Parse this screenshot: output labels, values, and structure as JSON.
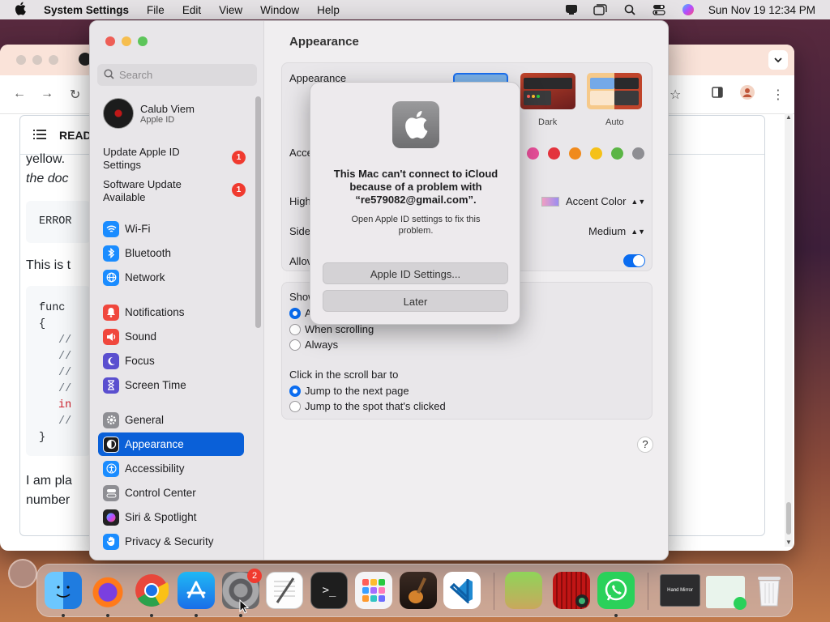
{
  "menubar": {
    "app": "System Settings",
    "items": [
      "File",
      "Edit",
      "View",
      "Window",
      "Help"
    ],
    "clock": "Sun Nov 19  12:34 PM"
  },
  "browser": {
    "readme": "READ",
    "lines": [
      "yellow.",
      "the doc",
      "ERROR",
      "This is t",
      "func",
      "{",
      "}",
      "I am pla",
      "number"
    ],
    "code_comment": "//",
    "code_kw": "in"
  },
  "sidebar": {
    "search_placeholder": "Search",
    "profile": {
      "name": "Calub Viem",
      "sub": "Apple ID"
    },
    "alerts": [
      {
        "label": "Update Apple ID Settings",
        "badge": "1"
      },
      {
        "label": "Software Update Available",
        "badge": "1"
      }
    ],
    "items": [
      {
        "label": "Wi-Fi",
        "icon": "wifi-icon",
        "color": "#1a8cff"
      },
      {
        "label": "Bluetooth",
        "icon": "bluetooth-icon",
        "color": "#1a8cff"
      },
      {
        "label": "Network",
        "icon": "globe-icon",
        "color": "#1a8cff"
      },
      {
        "label": "Notifications",
        "icon": "bell-icon",
        "color": "#f0473d"
      },
      {
        "label": "Sound",
        "icon": "speaker-icon",
        "color": "#f0473d"
      },
      {
        "label": "Focus",
        "icon": "moon-icon",
        "color": "#5a4fcf"
      },
      {
        "label": "Screen Time",
        "icon": "hourglass-icon",
        "color": "#5a4fcf"
      },
      {
        "label": "General",
        "icon": "gear-icon",
        "color": "#8e8e93"
      },
      {
        "label": "Appearance",
        "icon": "appearance-icon",
        "color": "#1c1c1e"
      },
      {
        "label": "Accessibility",
        "icon": "accessibility-icon",
        "color": "#1a8cff"
      },
      {
        "label": "Control Center",
        "icon": "control-center-icon",
        "color": "#8e8e93"
      },
      {
        "label": "Siri & Spotlight",
        "icon": "siri-icon",
        "color": "#222"
      },
      {
        "label": "Privacy & Security",
        "icon": "hand-icon",
        "color": "#1a8cff"
      }
    ],
    "active": "Appearance"
  },
  "main": {
    "title": "Appearance",
    "appearance_label": "Appearance",
    "appearance_options": [
      "Dark",
      "Auto"
    ],
    "accent_label": "Acce",
    "highlight_label": "High",
    "highlight_value": "Accent Color",
    "sidebar_label": "Side",
    "sidebar_value": "Medium",
    "allow_label": "Allov",
    "show_label": "Show",
    "show_first": "A",
    "show_options": [
      "When scrolling",
      "Always"
    ],
    "click_label": "Click in the scroll bar to",
    "click_options": [
      "Jump to the next page",
      "Jump to the spot that's clicked"
    ],
    "help": "?",
    "accent_colors": [
      "#e84f9a",
      "#e3333d",
      "#f08a1c",
      "#f5c118",
      "#5bb545",
      "#8e8e93"
    ]
  },
  "alert": {
    "title": "This Mac can't connect to iCloud because of a problem with “re579082@gmail.com”.",
    "message": "Open Apple ID settings to fix this problem.",
    "primary": "Apple ID Settings...",
    "secondary": "Later"
  },
  "dock": {
    "badge": "2",
    "apps": [
      "Finder",
      "Firefox",
      "Chrome",
      "App Store",
      "System Settings",
      "TextEdit",
      "Terminal",
      "Launchpad",
      "GarageBand",
      "Visual Studio Code",
      "Minecraft",
      "Photo Booth",
      "WhatsApp",
      "Hand Mirror",
      "Preview",
      "Trash"
    ],
    "thumb_label": "Hand Mirror"
  }
}
